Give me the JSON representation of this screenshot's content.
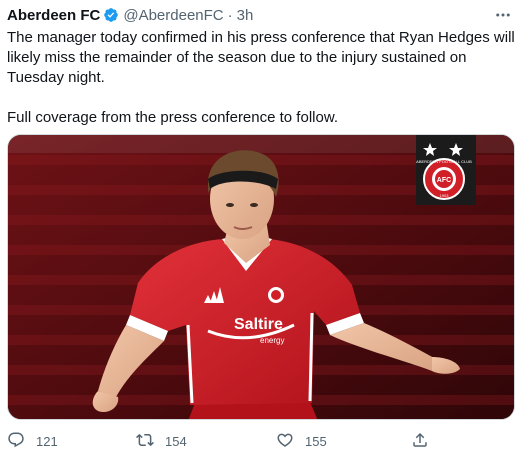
{
  "tweet": {
    "author_name": "Aberdeen FC",
    "handle": "@AberdeenFC",
    "separator": "·",
    "time": "3h",
    "text_paragraphs": [
      "The manager today confirmed in his press conference that Ryan Hedges will likely miss the remainder of the season due to the injury sustained on Tuesday night.",
      "Full coverage from the press conference to follow."
    ]
  },
  "media": {
    "sponsor_text": "Saltire",
    "sponsor_subtext": "energy",
    "crest_text": "ABERDEEN FOOTBALL CLUB",
    "crest_year": "1903",
    "crest_initials": "AFC"
  },
  "actions": {
    "reply_count": "121",
    "retweet_count": "154",
    "like_count": "155"
  },
  "icons": {
    "verified": "verified-badge-icon",
    "more": "more-options-icon",
    "reply": "reply-icon",
    "retweet": "retweet-icon",
    "like": "heart-icon",
    "share": "share-icon"
  },
  "colors": {
    "verified_blue": "#1d9bf0",
    "text_primary": "#0f1419",
    "text_secondary": "#536471",
    "club_red": "#d11f28"
  }
}
